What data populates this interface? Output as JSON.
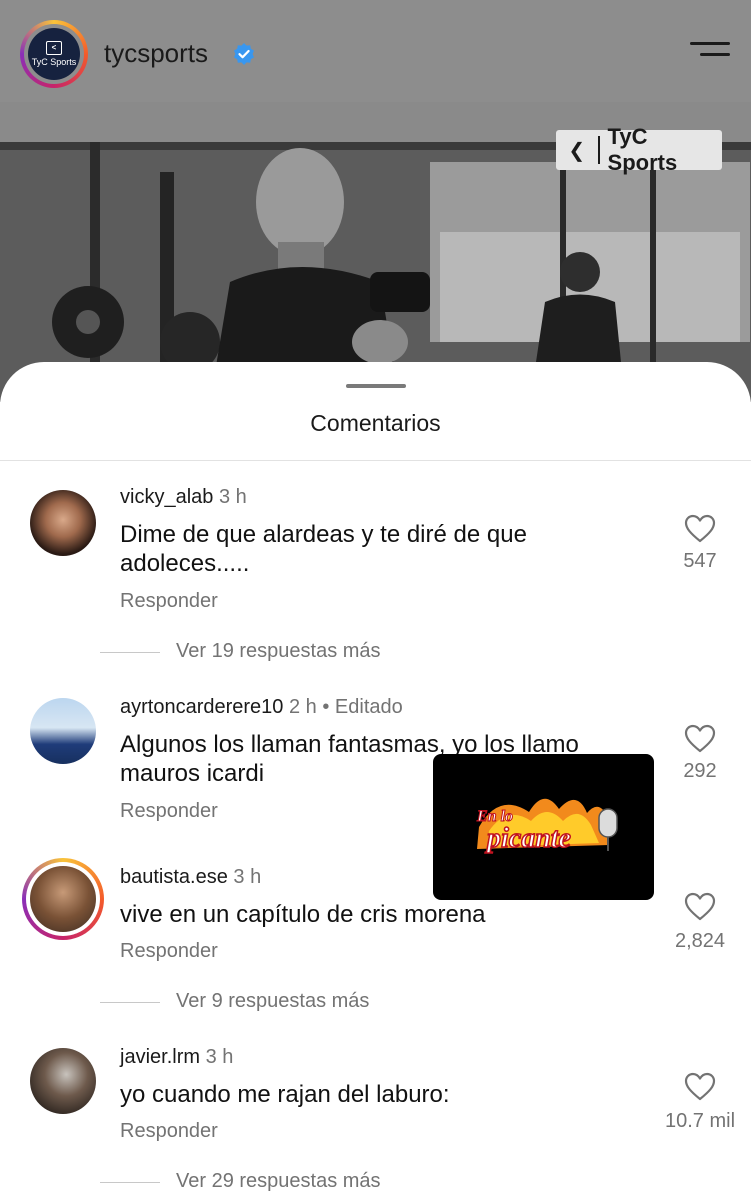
{
  "header": {
    "avatar_text": "TyC Sports",
    "account_name": "tycsports"
  },
  "photo": {
    "watermark": "TyC Sports"
  },
  "sheet": {
    "title": "Comentarios"
  },
  "comments": [
    {
      "username": "vicky_alab",
      "time": "3 h",
      "edited": "",
      "text_lines": [
        "Dime de que alardeas y te diré de que",
        "adoleces....."
      ],
      "reply_label": "Responder",
      "likes": "547",
      "more_replies": "Ver 19 respuestas más"
    },
    {
      "username": "ayrtoncarderere10",
      "time": "2 h",
      "edited": "• Editado",
      "text_lines": [
        "Algunos los llaman fantasmas, yo los llamo",
        "mauros icardi"
      ],
      "reply_label": "Responder",
      "likes": "292",
      "more_replies": ""
    },
    {
      "username": "bautista.ese",
      "time": "3 h",
      "edited": "",
      "text_lines": [
        "vive en un capítulo de cris morena"
      ],
      "reply_label": "Responder",
      "likes": "2,824",
      "more_replies": "Ver 9 respuestas más"
    },
    {
      "username": "javier.lrm",
      "time": "3 h",
      "edited": "",
      "text_lines": [
        "yo cuando me rajan del laburo:"
      ],
      "reply_label": "Responder",
      "likes": "10.7 mil",
      "more_replies": "Ver 29 respuestas más"
    }
  ],
  "overlay": {
    "logo_line1": "En lo",
    "logo_line2": "picante"
  },
  "colors": {
    "verified": "#3897f0",
    "secondary_text": "#737373",
    "story_ring": "#c7246a"
  }
}
